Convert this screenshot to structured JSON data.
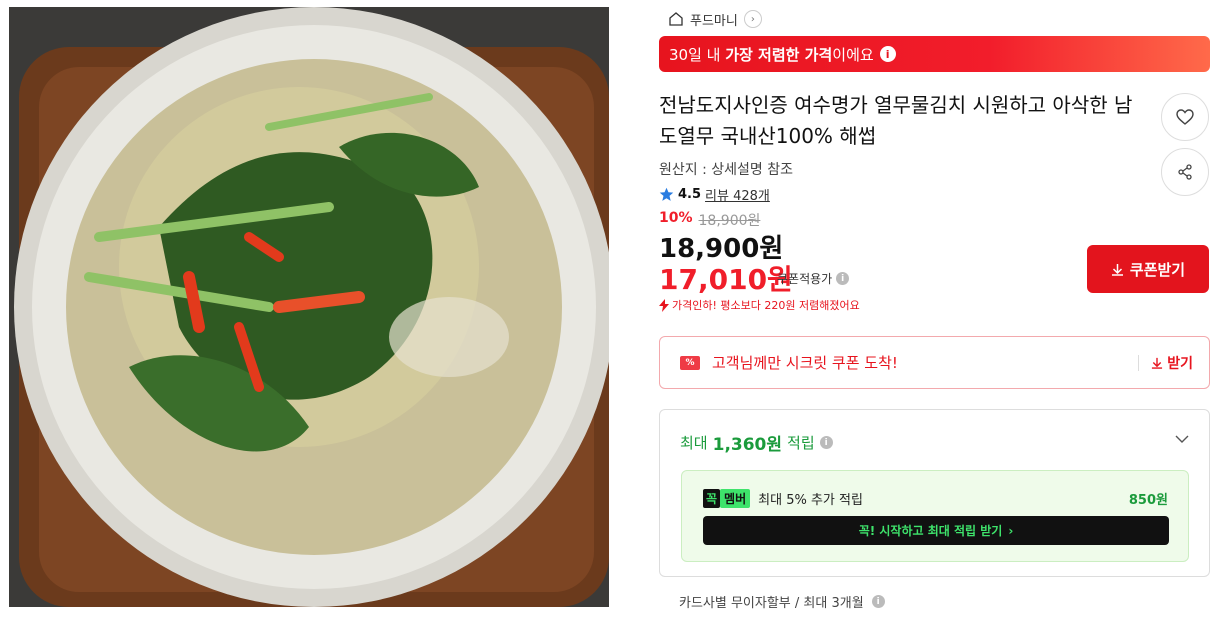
{
  "seller": {
    "name": "푸드마니",
    "home_icon": "home-icon",
    "chevron": "›"
  },
  "banner": {
    "prefix": "30일 내 ",
    "highlight": "가장 저렴한 가격",
    "suffix": "이에요",
    "info": "i"
  },
  "product": {
    "title": "전남도지사인증 여수명가 열무물김치 시원하고 아삭한 남도열무 국내산100% 해썹",
    "origin": "원산지 : 상세설명 참조",
    "rating": "4.5",
    "review": "리뷰 428개",
    "discount_rate": "10%",
    "original_price": "18,900원",
    "price": "18,900원",
    "coupon_price": "17,010원",
    "coupon_applied": "쿠폰적용가",
    "price_drop": "가격인하! 평소보다 220원 저렴해졌어요"
  },
  "coupon_button": {
    "label": "쿠폰받기"
  },
  "secret_coupon": {
    "badge": "%",
    "text": "고객님께만 시크릿 쿠폰 도착!",
    "action": "받기"
  },
  "points": {
    "prefix": "최대 ",
    "amount": "1,360원",
    "suffix": " 적립",
    "member": {
      "kkok": "꼭",
      "tag": "멤버",
      "text": "최대 5% 추가 적립",
      "amount": "850원",
      "button": "꼭! 시작하고 최대 적립 받기",
      "button_arrow": "›"
    }
  },
  "installment": {
    "text": "카드사별 무이자할부 / 최대 3개월"
  },
  "colors": {
    "accent_red": "#e7141e",
    "green": "#1b9b3c",
    "member_green": "#3ee36b"
  }
}
